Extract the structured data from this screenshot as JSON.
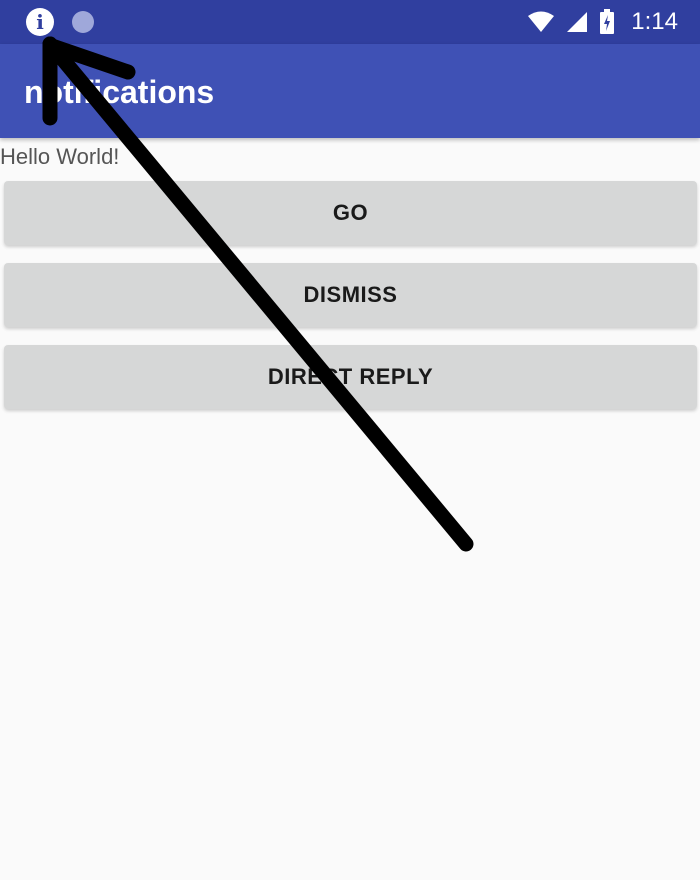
{
  "status_bar": {
    "time": "1:14",
    "icons": [
      "info-icon",
      "notification-dot-icon",
      "wifi-icon",
      "cell-signal-icon",
      "battery-icon"
    ],
    "background": "#303f9f"
  },
  "app_bar": {
    "title": "notifications",
    "background": "#3f51b5"
  },
  "content": {
    "hello_text": "Hello World!",
    "buttons": [
      {
        "label": "GO"
      },
      {
        "label": "DISMISS"
      },
      {
        "label": "DIRECT REPLY"
      }
    ]
  },
  "annotation": {
    "icon": "black-arrow-icon",
    "color": "#000000"
  }
}
